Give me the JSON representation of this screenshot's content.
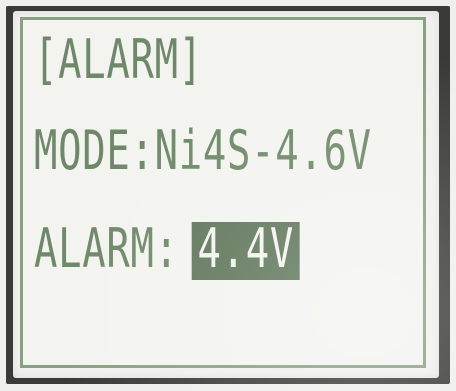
{
  "screen": {
    "title": "[ALARM]",
    "mode_label": "MODE:",
    "mode_value": "Ni4S-4.6V",
    "alarm_label": "ALARM:",
    "alarm_value": "4.4V"
  },
  "colors": {
    "lcd_text": "#6f8869",
    "highlight_background": "#5d7458",
    "lcd_background": "#f3f3f0"
  }
}
